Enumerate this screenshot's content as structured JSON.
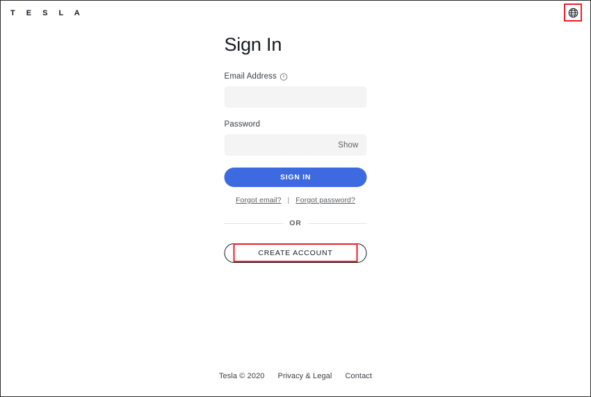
{
  "header": {
    "brand": "T E S L A",
    "language_icon": "globe-icon"
  },
  "main": {
    "title": "Sign In",
    "email": {
      "label": "Email Address",
      "info_icon": "info-circle-icon",
      "value": "",
      "placeholder": ""
    },
    "password": {
      "label": "Password",
      "value": "",
      "placeholder": "",
      "show_label": "Show"
    },
    "submit_label": "SIGN IN",
    "forgot_email": "Forgot email?",
    "link_separator": "|",
    "forgot_password": "Forgot password?",
    "divider_text": "OR",
    "create_account_label": "CREATE ACCOUNT"
  },
  "footer": {
    "copyright": "Tesla © 2020",
    "privacy": "Privacy & Legal",
    "contact": "Contact"
  },
  "annotations": {
    "highlight_color": "#ee1c25",
    "targets": [
      "language-globe-button",
      "create-account-button"
    ]
  },
  "colors": {
    "accent_blue": "#3e6ae1",
    "text_primary": "#171a20",
    "text_secondary": "#5c5e62",
    "input_bg": "#f4f4f4",
    "page_bg": "#ffffff"
  }
}
